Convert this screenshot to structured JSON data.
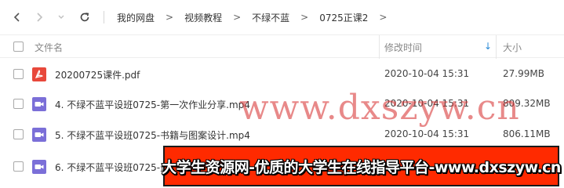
{
  "navbar": {
    "breadcrumbs": [
      "我的网盘",
      "视频教程",
      "不绿不蓝",
      "0725正课2"
    ],
    "separator": ">"
  },
  "table": {
    "headers": {
      "name": "文件名",
      "time": "修改时间",
      "size": "大小"
    },
    "sort_arrow": "↓",
    "rows": [
      {
        "name": "20200725课件.pdf",
        "time": "2020-10-04 15:31",
        "size": "27.99MB",
        "icon": "pdf-icon"
      },
      {
        "name": "4. 不绿不蓝平设班0725-第一次作业分享.mp4",
        "time": "2020-10-04 15:31",
        "size": "809.32MB",
        "icon": "video-icon"
      },
      {
        "name": "5. 不绿不蓝平设班0725-书籍与图案设计.mp4",
        "time": "2020-10-04 15:31",
        "size": "806.11MB",
        "icon": "video-icon"
      },
      {
        "name": "6. 不绿不蓝平设班0725-选",
        "time": "",
        "size": "",
        "icon": "video-icon"
      }
    ]
  },
  "watermark": "www.dxszyw.cn",
  "banner": "大学生资源网-优质的大学生在线指导平台-www.dxszyw.cn",
  "colors": {
    "pdf": "#e8483b",
    "video": "#7b6fd8",
    "accent": "#2b8ad6",
    "banner": "#ff2a00"
  }
}
